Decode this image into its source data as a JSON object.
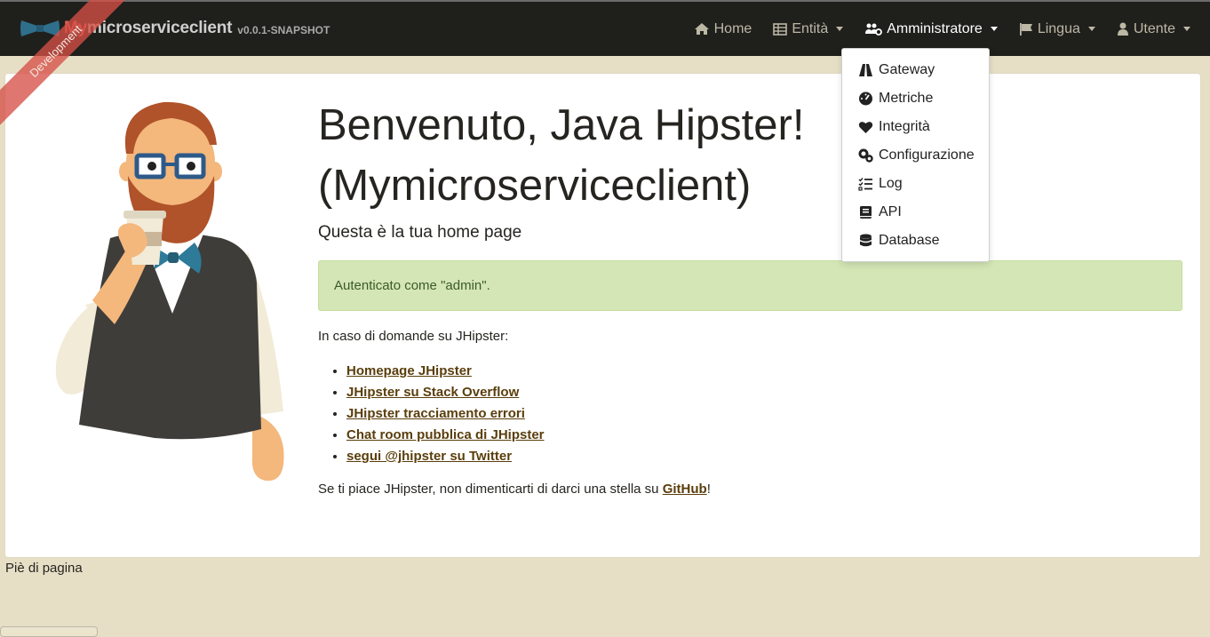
{
  "navbar": {
    "brand_accent": "My",
    "brand_rest": "microserviceclient",
    "version": "v0.0.1-SNAPSHOT",
    "items": [
      {
        "label": "Home",
        "icon": "home-icon",
        "dropdown": false
      },
      {
        "label": "Entità",
        "icon": "table-icon",
        "dropdown": true
      },
      {
        "label": "Amministratore",
        "icon": "users-cog-icon",
        "dropdown": true,
        "active": true
      },
      {
        "label": "Lingua",
        "icon": "flag-icon",
        "dropdown": true
      },
      {
        "label": "Utente",
        "icon": "user-icon",
        "dropdown": true
      }
    ]
  },
  "ribbon": {
    "label": "Development"
  },
  "admin_menu": {
    "items": [
      {
        "label": "Gateway",
        "icon": "road-icon"
      },
      {
        "label": "Metriche",
        "icon": "tachometer-icon"
      },
      {
        "label": "Integrità",
        "icon": "heart-icon"
      },
      {
        "label": "Configurazione",
        "icon": "cogs-icon"
      },
      {
        "label": "Log",
        "icon": "tasks-icon"
      },
      {
        "label": "API",
        "icon": "book-icon"
      },
      {
        "label": "Database",
        "icon": "database-icon"
      }
    ]
  },
  "main": {
    "title_line1": "Benvenuto, Java Hipster!",
    "title_line2": "(Mymicroserviceclient)",
    "subtitle": "Questa è la tua home page",
    "alert": "Autenticato come \"admin\".",
    "question": "In caso di domande su JHipster:",
    "links": [
      "Homepage JHipster",
      "JHipster su Stack Overflow",
      "JHipster tracciamento errori",
      "Chat room pubblica di JHipster",
      "segui @jhipster su Twitter"
    ],
    "star_prefix": "Se ti piace JHipster, non dimenticarti di darci una stella su ",
    "star_link": "GitHub",
    "star_suffix": "!"
  },
  "footer": {
    "text": "Piè di pagina"
  },
  "colors": {
    "navbar_bg": "#1f201c",
    "page_bg": "#e6dfc6",
    "brand_accent": "#e25f56",
    "alert_bg": "#d4e6b5",
    "link": "#5a3e0c"
  }
}
